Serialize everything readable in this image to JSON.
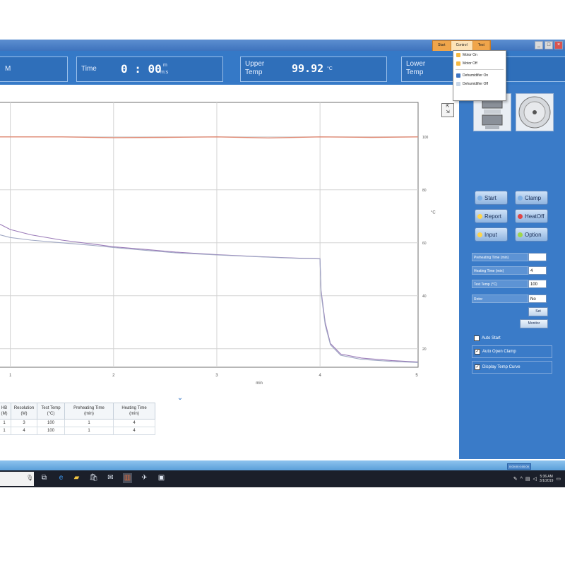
{
  "window": {
    "menu": [
      "Start",
      "Control",
      "Test"
    ],
    "active_menu": 1,
    "dropdown_items": [
      {
        "label": "Motor On",
        "icon": "motor-icon"
      },
      {
        "label": "Motor Off",
        "icon": "motor-icon"
      },
      {
        "label": "Dehumidifier On",
        "icon": "dehumidifier-icon"
      },
      {
        "label": "Dehumidifier Off",
        "icon": "dehumidifier-icon"
      }
    ],
    "controls": [
      "_",
      "□",
      "×"
    ]
  },
  "header": {
    "left_label": "M",
    "time_label": "Time",
    "time_value": "0 : 00",
    "time_unit_top": "m",
    "time_unit_bottom": "m:s",
    "upper_label_1": "Upper",
    "upper_label_2": "Temp",
    "upper_value": "99.92",
    "upper_unit": "°C",
    "lower_label_1": "Lower",
    "lower_label_2": "Temp"
  },
  "chart_data": {
    "type": "line",
    "xlabel": "min",
    "y2label": "°C",
    "xlim": [
      0.9,
      4.95
    ],
    "ylim": [
      13,
      113
    ],
    "x_ticks": [
      1,
      2,
      3,
      4,
      5
    ],
    "y_ticks": [
      20,
      40,
      60,
      80,
      100
    ],
    "grid": true,
    "series": [
      {
        "color": "#e08a74",
        "x": [
          0.9,
          1.5,
          2.0,
          2.5,
          3.0,
          3.5,
          4.0,
          4.5,
          4.95
        ],
        "y": [
          100,
          100,
          99.7,
          99.8,
          100,
          99.6,
          100,
          99.8,
          100
        ]
      },
      {
        "color": "#9a7ab8",
        "x": [
          0.9,
          1.0,
          1.2,
          1.5,
          1.8,
          2.0,
          2.3,
          2.6,
          3.0,
          3.4,
          3.8,
          4.0,
          4.01,
          4.05,
          4.1,
          4.2,
          4.4,
          4.7,
          4.95
        ],
        "y": [
          67,
          65,
          63,
          61,
          59.5,
          58.5,
          57.5,
          56.5,
          55.5,
          54.8,
          54.2,
          54,
          42,
          30,
          22,
          18,
          16.5,
          15.5,
          15
        ]
      },
      {
        "color": "#a0a8c4",
        "x": [
          0.9,
          1.0,
          1.2,
          1.5,
          1.8,
          2.0,
          2.3,
          2.6,
          3.0,
          3.4,
          3.8,
          4.0,
          4.01,
          4.05,
          4.1,
          4.2,
          4.4,
          4.7,
          4.95
        ],
        "y": [
          63,
          62,
          61,
          60,
          59,
          58.2,
          57.2,
          56.2,
          55.4,
          54.7,
          54.1,
          53.9,
          41,
          29,
          21.5,
          17.5,
          16,
          15.2,
          14.8
        ]
      }
    ]
  },
  "panel": {
    "buttons": [
      {
        "label": "Start",
        "color": "#7fb1e6"
      },
      {
        "label": "Clamp",
        "color": "#7fb1e6"
      },
      {
        "label": "Report",
        "color": "#ffd54a"
      },
      {
        "label": "HeatOff",
        "color": "#e04646"
      },
      {
        "label": "Input",
        "color": "#ffd54a"
      },
      {
        "label": "Option",
        "color": "#9fd64a"
      }
    ],
    "fields": [
      {
        "label": "Preheating Time (min)",
        "value": ""
      },
      {
        "label": "Heating Time (min)",
        "value": "4"
      },
      {
        "label": "Test Temp (°C)",
        "value": "100"
      },
      {
        "label": "Rotor",
        "value": "No"
      }
    ],
    "set_label": "Set",
    "monitor_label": "Monitor",
    "checkboxes": [
      {
        "label": "Auto Start",
        "checked": false
      },
      {
        "label": "Auto Open Clamp",
        "checked": true
      },
      {
        "label": "Display Temp Curve",
        "checked": true
      }
    ]
  },
  "table": {
    "headers": [
      "HB\n(M)",
      "Resolution\n(M)",
      "Test Temp\n(°C)",
      "Preheating Time\n(min)",
      "Heating Time\n(min)"
    ],
    "rows": [
      [
        "1",
        "3",
        "100",
        "1",
        "4"
      ],
      [
        "1",
        "4",
        "100",
        "1",
        "4"
      ]
    ]
  },
  "status": {
    "bottom_label": "0:00:00 0:00:00"
  },
  "taskbar": {
    "clock_time": "5:36 AM",
    "clock_date": "3/1/2019"
  }
}
